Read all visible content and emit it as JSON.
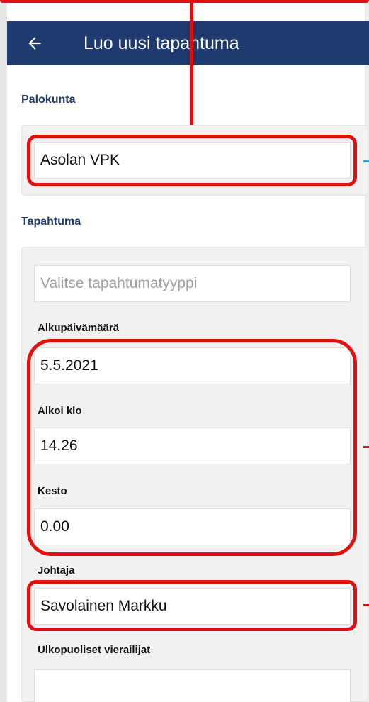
{
  "app_bar": {
    "title": "Luo uusi tapahtuma",
    "back_icon": "arrow-left-icon"
  },
  "sections": {
    "fire_brigade_label": "Palokunta",
    "event_label": "Tapahtuma"
  },
  "fields": {
    "fire_brigade_value": "Asolan VPK",
    "event_type_placeholder": "Valitse tapahtumatyyppi",
    "start_date_label": "Alkupäivämäärä",
    "start_date_value": "5.5.2021",
    "start_time_label": "Alkoi klo",
    "start_time_value": "14.26",
    "duration_label": "Kesto",
    "duration_value": "0.00",
    "leader_label": "Johtaja",
    "leader_value": "Savolainen Markku",
    "visitors_label": "Ulkopuoliset vierailijat",
    "visitors_value": ""
  },
  "colors": {
    "app_bar": "#1f3a6e",
    "highlight": "#e01010",
    "section_label": "#1f3a6e"
  }
}
